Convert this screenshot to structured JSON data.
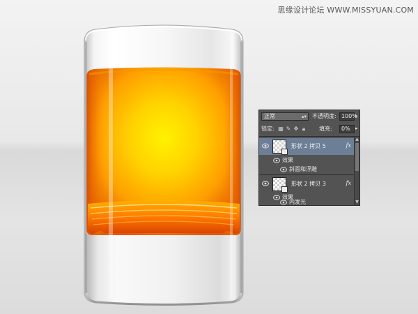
{
  "watermark": "思缘设计论坛  WWW.MISSYUAN.COM",
  "colors": {
    "liquid_core": "#fff200",
    "liquid_edge": "#e25a00",
    "panel_bg": "#535353",
    "selected_row": "#6d7f96"
  },
  "layers_panel": {
    "blend_mode": "正常",
    "opacity_label": "不透明度:",
    "opacity_value": "100%",
    "lock_label": "锁定:",
    "fill_label": "填充:",
    "fill_value": "0%",
    "layers": [
      {
        "name": "形状 2 拷贝 5",
        "selected": true,
        "fx": "fx",
        "effects_label": "效果",
        "effects": [
          "斜面和浮雕"
        ]
      },
      {
        "name": "形状 2 拷贝 3",
        "selected": false,
        "fx": "fx",
        "effects_label": "效果",
        "effects": [
          "内发光"
        ]
      }
    ]
  }
}
